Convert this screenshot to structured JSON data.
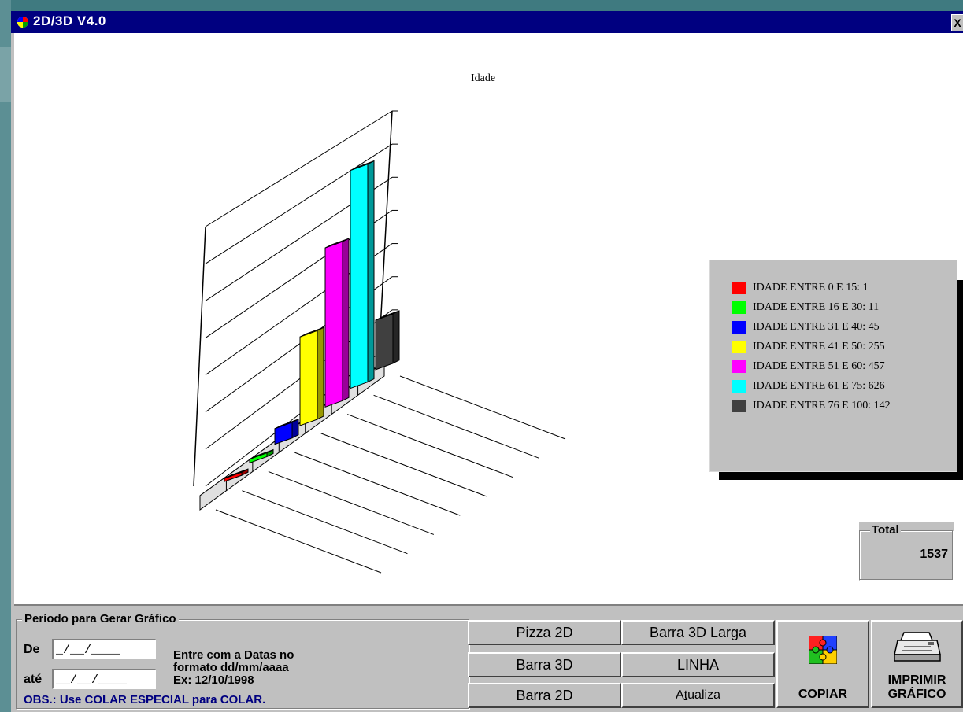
{
  "window": {
    "title": "2D/3D V4.0",
    "close_label": "X"
  },
  "chart": {
    "title": "Idade"
  },
  "chart_data": {
    "type": "bar",
    "title": "Idade",
    "categories": [
      "IDADE ENTRE 0 E 15",
      "IDADE ENTRE 16 E 30",
      "IDADE ENTRE 31 E 40",
      "IDADE ENTRE 41 E 50",
      "IDADE ENTRE 51 E 60",
      "IDADE ENTRE 61 E 75",
      "IDADE ENTRE 76 E 100"
    ],
    "values": [
      1,
      11,
      45,
      255,
      457,
      626,
      142
    ],
    "colors": [
      "#ff0000",
      "#00ff00",
      "#0000ff",
      "#ffff00",
      "#ff00ff",
      "#00ffff",
      "#404040"
    ],
    "ylim": [
      0,
      700
    ],
    "grid": true,
    "style": "3D bars",
    "legend_position": "right"
  },
  "legend": {
    "items": [
      {
        "label": "IDADE ENTRE 0 E 15:  1",
        "color": "#ff0000"
      },
      {
        "label": "IDADE ENTRE 16 E 30:  11",
        "color": "#00ff00"
      },
      {
        "label": "IDADE ENTRE 31 E 40:  45",
        "color": "#0000ff"
      },
      {
        "label": "IDADE ENTRE 41 E 50:  255",
        "color": "#ffff00"
      },
      {
        "label": "IDADE ENTRE 51 E 60:  457",
        "color": "#ff00ff"
      },
      {
        "label": "IDADE ENTRE 61 E 75:  626",
        "color": "#00ffff"
      },
      {
        "label": "IDADE ENTRE 76 E 100:  142",
        "color": "#404040"
      }
    ]
  },
  "total": {
    "label": "Total",
    "value": "1537"
  },
  "period": {
    "title": "Período para Gerar Gráfico",
    "from_label": "De",
    "from_value": "_/__/____",
    "to_label": "até",
    "to_value": "__/__/____",
    "hint_line1": "Entre com a Datas no",
    "hint_line2": "formato dd/mm/aaaa",
    "hint_line3": "Ex: 12/10/1998",
    "obs": "OBS.: Use COLAR ESPECIAL para COLAR."
  },
  "buttons": {
    "pizza2d": "Pizza 2D",
    "barra3d_larga": "Barra 3D Larga",
    "barra3d": "Barra 3D",
    "linha": "LINHA",
    "barra2d": "Barra 2D",
    "atualiza_pre": "A",
    "atualiza_u": "t",
    "atualiza_post": "ualiza",
    "copiar": "COPIAR",
    "imprimir_line1": "IMPRIMIR",
    "imprimir_line2": "GRÁFICO"
  }
}
